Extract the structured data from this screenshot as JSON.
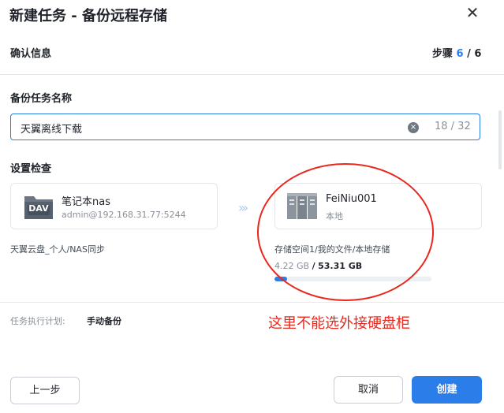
{
  "dialog": {
    "title": "新建任务 - 备份远程存储",
    "close_label": "✕"
  },
  "confirm_section": {
    "label": "确认信息",
    "step_prefix": "步骤",
    "step_current": "6",
    "step_sep": "/",
    "step_total": "6"
  },
  "task_name": {
    "label": "备份任务名称",
    "value": "天翼离线下载",
    "clear_label": "×",
    "count": "18 / 32"
  },
  "settings_check": {
    "label": "设置检查",
    "source": {
      "icon": "dav-folder-icon",
      "badge": "DAV",
      "title": "笔记本nas",
      "subtitle": "admin@192.168.31.77:5244",
      "path": "天翼云盘_个人/NAS同步"
    },
    "arrow_label": "›››",
    "destination": {
      "icon": "server-rack-icon",
      "title": "FeiNiu001",
      "subtitle": "本地",
      "path": "存储空间1/我的文件/本地存储",
      "used": "4.22 GB",
      "separator": "/",
      "total": "53.31 GB",
      "usage_fraction": 0.079
    }
  },
  "schedule": {
    "label": "任务执行计划:",
    "value": "手动备份"
  },
  "annotation": {
    "text": "这里不能选外接硬盘柜",
    "color": "#e8281e"
  },
  "footer": {
    "prev_label": "上一步",
    "cancel_label": "取消",
    "create_label": "创建"
  },
  "colors": {
    "accent": "#2b7de9"
  }
}
